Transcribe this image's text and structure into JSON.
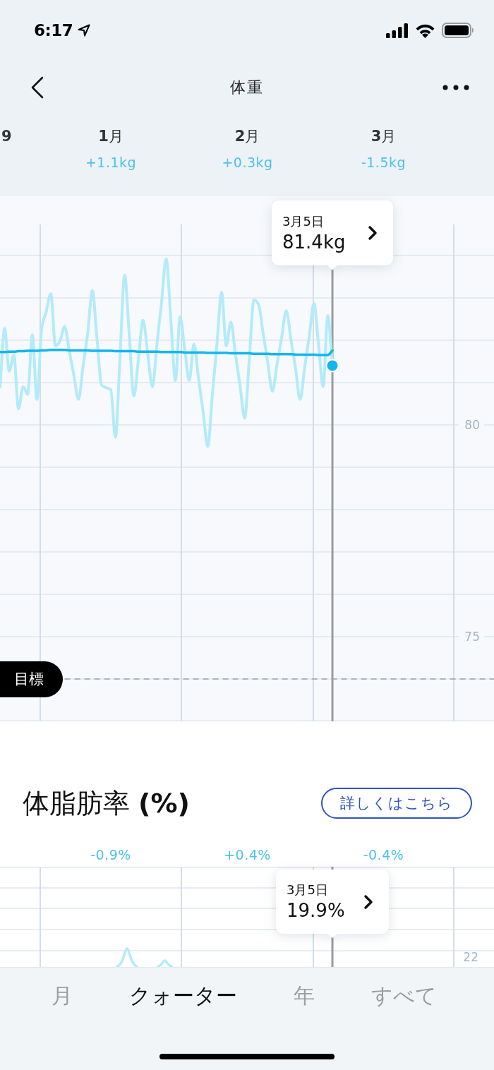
{
  "status_bar": {
    "time": "6:17"
  },
  "nav": {
    "title": "体重"
  },
  "weight": {
    "partial_month_label": "9",
    "months": [
      {
        "label": "**1**月",
        "delta": "+1.1kg"
      },
      {
        "label": "**2**月",
        "delta": "+0.3kg"
      },
      {
        "label": "**3**月",
        "delta": "-1.5kg"
      }
    ],
    "chart_data": {
      "type": "line",
      "categories": [
        null,
        null,
        null,
        null,
        null,
        null,
        null,
        null,
        null,
        null,
        null,
        null,
        null,
        null,
        null,
        null,
        null,
        null,
        null,
        null,
        null,
        null,
        null,
        null,
        null,
        null,
        null,
        null,
        null,
        null,
        null,
        null,
        null,
        null,
        null,
        null,
        null,
        null,
        null,
        null,
        null,
        null,
        null,
        null,
        null,
        null,
        null,
        null,
        null,
        null,
        null,
        null,
        null,
        null,
        null,
        null,
        null,
        null,
        null,
        null,
        null,
        null,
        null,
        null,
        null,
        null,
        null,
        null,
        null,
        null,
        null,
        null,
        null,
        null,
        null,
        null,
        null,
        null,
        null,
        null,
        null,
        null,
        null,
        null,
        null,
        null,
        null,
        null,
        null,
        null,
        null,
        null,
        null,
        null,
        null,
        null,
        null,
        null,
        null,
        null,
        null,
        null,
        null,
        null,
        null,
        null,
        null,
        null
      ],
      "series": [
        {
          "color": "#b3ebfa",
          "values": [
            80.9,
            82.28,
            81.27,
            81.65,
            80.38,
            80.9,
            80.72,
            82.13,
            80.6,
            82.24,
            82.67,
            83.1,
            81.87,
            81.98,
            82.32,
            81.75,
            81.17,
            80.6,
            81.39,
            82.17,
            83.17,
            82.05,
            80.94,
            80.88,
            80.83,
            79.71,
            81.62,
            83.54,
            82.11,
            80.68,
            81.57,
            82.47,
            81.68,
            80.9,
            81.91,
            82.91,
            83.92,
            82.48,
            81.05,
            82.55,
            81.8,
            81.05,
            81.91,
            81.1,
            80.3,
            79.49,
            80.7,
            81.92,
            83.13,
            81.87,
            82.43,
            81.67,
            80.92,
            80.16,
            81.56,
            82.95,
            82.84,
            82.16,
            81.47,
            80.79,
            81.43,
            82.06,
            82.7,
            82.03,
            81.35,
            80.6,
            81.36,
            82.11,
            82.87,
            81.89,
            80.9,
            82.58,
            81.4,
            null,
            null,
            null,
            null,
            null,
            null,
            null,
            null,
            null,
            null,
            null,
            null,
            null,
            null,
            null,
            null,
            null,
            null,
            null,
            null,
            null,
            null,
            null,
            null,
            null,
            null,
            null,
            null,
            null,
            null,
            null,
            null,
            null,
            null,
            null
          ]
        },
        {
          "color": "#12b6ee",
          "values": [
            81.72,
            81.72,
            81.73,
            81.73,
            81.74,
            81.74,
            81.75,
            81.75,
            81.75,
            81.76,
            81.76,
            81.77,
            81.77,
            81.77,
            81.77,
            81.76,
            81.76,
            81.76,
            81.76,
            81.76,
            81.75,
            81.75,
            81.75,
            81.75,
            81.75,
            81.74,
            81.74,
            81.74,
            81.74,
            81.74,
            81.73,
            81.73,
            81.73,
            81.73,
            81.73,
            81.72,
            81.72,
            81.72,
            81.72,
            81.72,
            81.71,
            81.71,
            81.71,
            81.71,
            81.71,
            81.7,
            81.7,
            81.7,
            81.7,
            81.7,
            81.69,
            81.69,
            81.69,
            81.69,
            81.69,
            81.68,
            81.68,
            81.68,
            81.68,
            81.67,
            81.67,
            81.67,
            81.67,
            81.67,
            81.66,
            81.66,
            81.66,
            81.66,
            81.66,
            81.65,
            81.65,
            81.65,
            81.76,
            null,
            null,
            null,
            null,
            null,
            null,
            null,
            null,
            null,
            null,
            null,
            null,
            null,
            null,
            null,
            null,
            null,
            null,
            null,
            null,
            null,
            null,
            null,
            null,
            null,
            null,
            null,
            null,
            null,
            null,
            null,
            null,
            null,
            null,
            null
          ]
        },
        {
          "name": "目標",
          "color": "#9ea3a8",
          "line_style": "dashed",
          "values": [
            null,
            null,
            null,
            null,
            null,
            null,
            null,
            null,
            null,
            null,
            null,
            null,
            null,
            null,
            74,
            74,
            74,
            74,
            74,
            74,
            74,
            74,
            74,
            74,
            74,
            74,
            74,
            74,
            74,
            74,
            74,
            74,
            74,
            74,
            74,
            74,
            74,
            74,
            74,
            74,
            74,
            74,
            74,
            74,
            74,
            74,
            74,
            74,
            74,
            74,
            74,
            74,
            74,
            74,
            74,
            74,
            74,
            74,
            74,
            74,
            74,
            74,
            74,
            74,
            74,
            74,
            74,
            74,
            74,
            74,
            74,
            74,
            74,
            74,
            74,
            74,
            74,
            74,
            74,
            74,
            74,
            74,
            74,
            74,
            74,
            74,
            74,
            74,
            74,
            74,
            74,
            74,
            74,
            74,
            74,
            74,
            74,
            74,
            74,
            74,
            74,
            74,
            74,
            74,
            74,
            74,
            74,
            74
          ]
        }
      ],
      "ylim": [
        73,
        85.4
      ],
      "yticks": [
        75,
        80
      ]
    },
    "tooltip": {
      "date": "3月5日",
      "value": "81.4kg"
    }
  },
  "body_fat": {
    "title": "体脂肪率 **(%)**",
    "details_button": "詳しくはこちら",
    "deltas": [
      "-0.9%",
      "+0.4%",
      "-0.4%"
    ],
    "tooltip": {
      "date": "3月5日",
      "value": "19.9%"
    },
    "y_tick_label": "22"
  },
  "period_tabs": [
    {
      "label": "月",
      "selected": false
    },
    {
      "label": "クォーター",
      "selected": true
    },
    {
      "label": "年",
      "selected": false
    },
    {
      "label": "すべて",
      "selected": false
    }
  ]
}
